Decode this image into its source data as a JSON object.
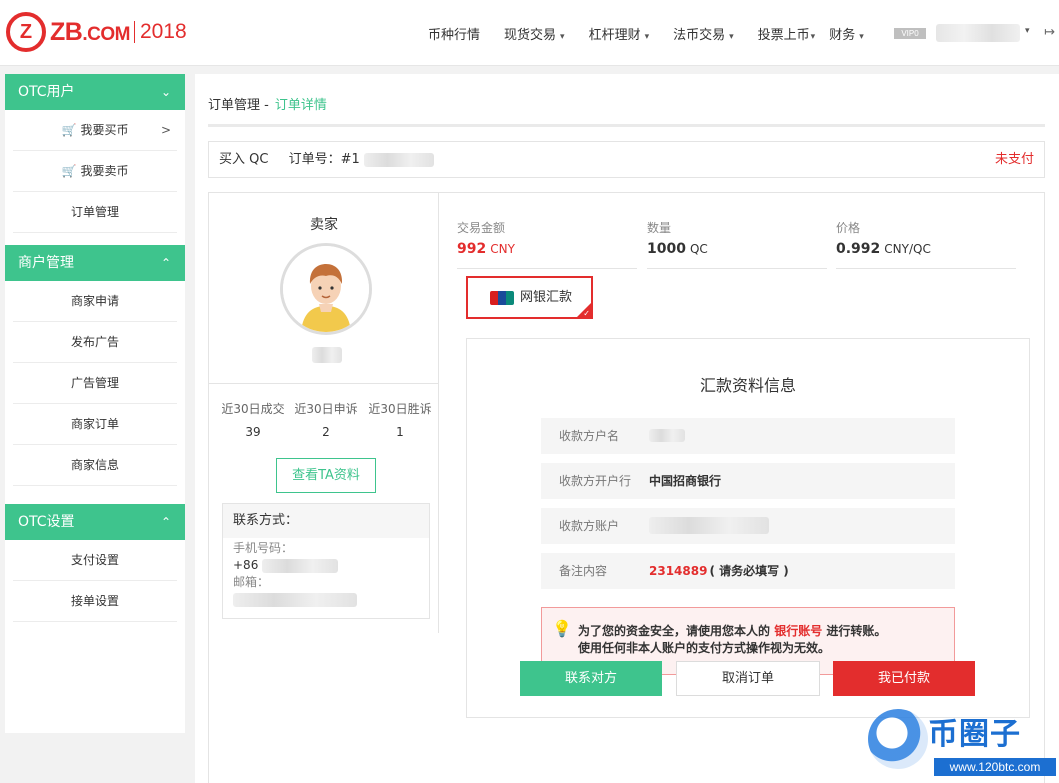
{
  "header": {
    "logo_text": "ZB",
    "logo_suffix": ".COM",
    "logo_year": "2018",
    "nav": [
      {
        "label": "币种行情",
        "has_caret": false
      },
      {
        "label": "现货交易",
        "has_caret": true
      },
      {
        "label": "杠杆理财",
        "has_caret": true
      },
      {
        "label": "法币交易",
        "has_caret": true
      },
      {
        "label": "投票上币",
        "has_caret": true
      },
      {
        "label": "财务",
        "has_caret": true
      }
    ],
    "vip_badge": "VIP0",
    "caret": "▾",
    "exit_icon": "↦"
  },
  "sidebar": {
    "groups": [
      {
        "title": "OTC用户",
        "chevron": "⌄",
        "items": [
          {
            "label": "我要买币",
            "icon": "cart-red-icon",
            "arrow": ">"
          },
          {
            "label": "我要卖币",
            "icon": "cart-green-icon"
          },
          {
            "label": "订单管理"
          }
        ]
      },
      {
        "title": "商户管理",
        "chevron": "⌃",
        "items": [
          {
            "label": "商家申请"
          },
          {
            "label": "发布广告"
          },
          {
            "label": "广告管理"
          },
          {
            "label": "商家订单"
          },
          {
            "label": "商家信息"
          }
        ]
      },
      {
        "title": "OTC设置",
        "chevron": "⌃",
        "items": [
          {
            "label": "支付设置"
          },
          {
            "label": "接单设置"
          }
        ]
      }
    ]
  },
  "breadcrumb": {
    "parent": "订单管理 -",
    "current": "订单详情"
  },
  "order": {
    "type": "买入 QC",
    "number_label": "订单号：#",
    "number_visible": "1",
    "status": "未支付"
  },
  "seller": {
    "title": "卖家",
    "stats": [
      {
        "label": "近30日成交",
        "value": "39"
      },
      {
        "label": "近30日申诉",
        "value": "2"
      },
      {
        "label": "近30日胜诉",
        "value": "1"
      }
    ],
    "view_button": "查看TA资料",
    "contact_title": "联系方式：",
    "phone_label": "手机号码：",
    "phone_prefix": "+86",
    "email_label": "邮箱："
  },
  "summary": {
    "amount": {
      "label": "交易金额",
      "value": "992",
      "unit": "CNY"
    },
    "quantity": {
      "label": "数量",
      "value": "1000",
      "unit": "QC"
    },
    "price": {
      "label": "价格",
      "value": "0.992",
      "unit": "CNY/QC"
    }
  },
  "payment_method": {
    "label": "网银汇款",
    "logo_text": "UnionPay 银联",
    "check": "✓"
  },
  "remit": {
    "title": "汇款资料信息",
    "rows": [
      {
        "key": "收款方户名",
        "value": ""
      },
      {
        "key": "收款方开户行",
        "value": "中国招商银行"
      },
      {
        "key": "收款方账户",
        "value": ""
      },
      {
        "key": "备注内容",
        "value": "2314889",
        "note": "( 请务必填写 )"
      }
    ],
    "warning": {
      "line1_a": "为了您的资金安全，请使用您本人的",
      "line1_highlight": "银行账号",
      "line1_b": "进行转账。",
      "line2": "使用任何非本人账户的支付方式操作视为无效。"
    }
  },
  "buttons": {
    "contact": "联系对方",
    "cancel": "取消订单",
    "paid": "我已付款"
  },
  "watermark": {
    "text": "币圈子",
    "url": "www.120btc.com"
  },
  "colors": {
    "accent_green": "#3ec48d",
    "brand_red": "#e32d2d"
  }
}
